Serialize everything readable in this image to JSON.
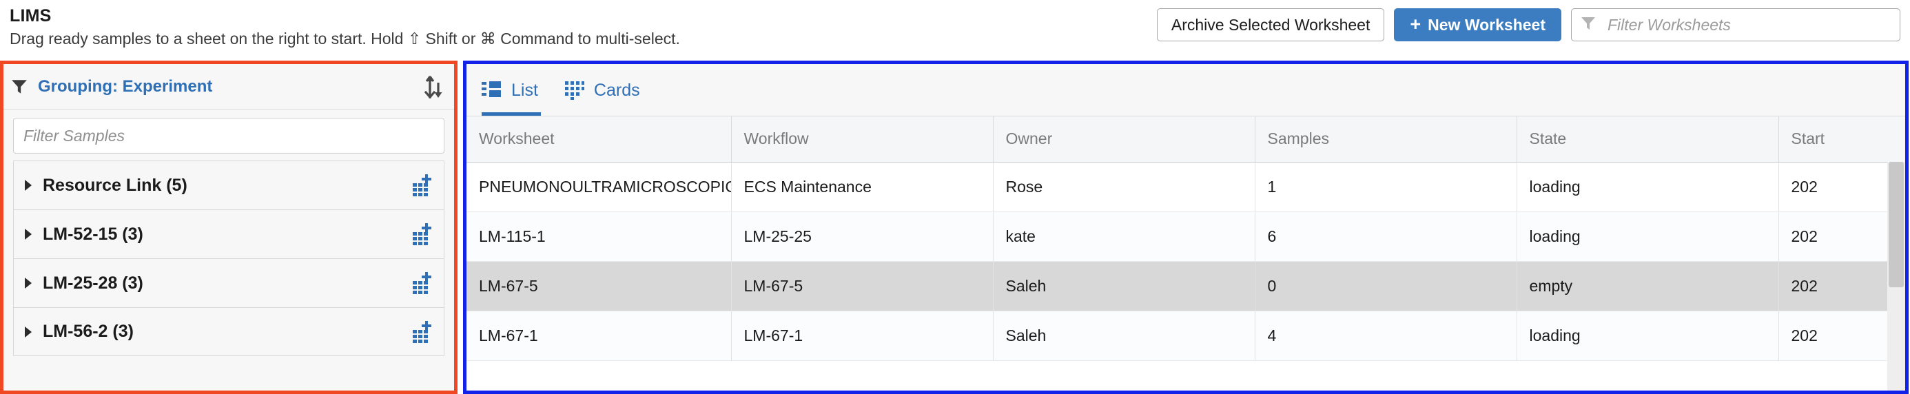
{
  "header": {
    "title": "LIMS",
    "subtitle": "Drag ready samples to a sheet on the right to start. Hold ⇧ Shift or ⌘ Command to multi-select.",
    "archive_button": "Archive Selected Worksheet",
    "new_worksheet_button": "New Worksheet",
    "new_worksheet_plus": "+",
    "filter_worksheets_placeholder": "Filter Worksheets",
    "filter_worksheets_value": ""
  },
  "samples_panel": {
    "grouping_label": "Grouping: Experiment",
    "filter_samples_placeholder": "Filter Samples",
    "filter_samples_value": "",
    "groups": [
      {
        "label": "Resource Link (5)"
      },
      {
        "label": "LM-52-15 (3)"
      },
      {
        "label": "LM-25-28 (3)"
      },
      {
        "label": "LM-56-2 (3)"
      }
    ]
  },
  "worksheets_panel": {
    "tabs": [
      {
        "label": "List",
        "active": true
      },
      {
        "label": "Cards",
        "active": false
      }
    ],
    "columns": [
      "Worksheet",
      "Workflow",
      "Owner",
      "Samples",
      "State",
      "Start"
    ],
    "rows": [
      {
        "worksheet": "PNEUMONOULTRAMICROSCOPIC",
        "workflow": "ECS Maintenance",
        "owner": "Rose",
        "samples": "1",
        "state": "loading",
        "start": "202",
        "selected": false
      },
      {
        "worksheet": "LM-115-1",
        "workflow": "LM-25-25",
        "owner": "kate",
        "samples": "6",
        "state": "loading",
        "start": "202",
        "selected": false
      },
      {
        "worksheet": "LM-67-5",
        "workflow": "LM-67-5",
        "owner": "Saleh",
        "samples": "0",
        "state": "empty",
        "start": "202",
        "selected": true
      },
      {
        "worksheet": "LM-67-1",
        "workflow": "LM-67-1",
        "owner": "Saleh",
        "samples": "4",
        "state": "loading",
        "start": "202",
        "selected": false
      }
    ]
  },
  "colors": {
    "accent_blue": "#2e6fb5",
    "primary_button": "#3b7dc0",
    "samples_panel_outline": "#ef4823",
    "worksheets_panel_outline": "#1322e8",
    "selected_row": "#d8d8d8"
  }
}
